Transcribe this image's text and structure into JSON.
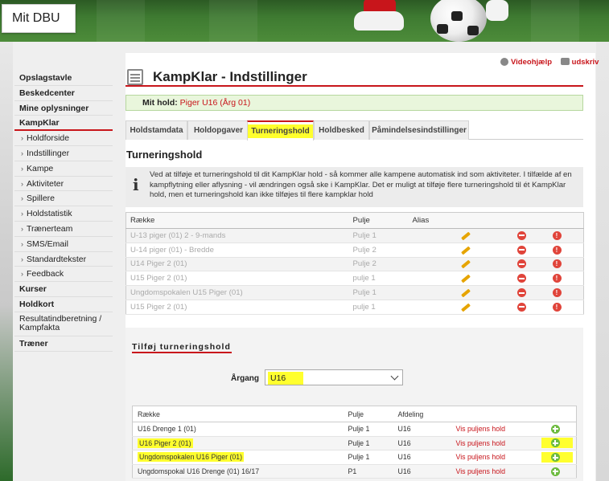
{
  "header": {
    "logo_text": "Mit DBU"
  },
  "top_links": {
    "video_help": "Videohjælp",
    "print": "udskriv"
  },
  "sidebar": {
    "items": [
      {
        "label": "Opslagstavle",
        "kind": "bold"
      },
      {
        "label": "Beskedcenter",
        "kind": "bold"
      },
      {
        "label": "Mine oplysninger",
        "kind": "bold"
      },
      {
        "label": "KampKlar",
        "kind": "active"
      },
      {
        "label": "Holdforside",
        "kind": "sub"
      },
      {
        "label": "Indstillinger",
        "kind": "sub"
      },
      {
        "label": "Kampe",
        "kind": "sub"
      },
      {
        "label": "Aktiviteter",
        "kind": "sub"
      },
      {
        "label": "Spillere",
        "kind": "sub"
      },
      {
        "label": "Holdstatistik",
        "kind": "sub"
      },
      {
        "label": "Trænerteam",
        "kind": "sub"
      },
      {
        "label": "SMS/Email",
        "kind": "sub"
      },
      {
        "label": "Standardtekster",
        "kind": "sub"
      },
      {
        "label": "Feedback",
        "kind": "sub"
      },
      {
        "label": "Kurser",
        "kind": "bold"
      },
      {
        "label": "Holdkort",
        "kind": "bold"
      },
      {
        "label": "Resultatindberetning / Kampfakta",
        "kind": "multi"
      },
      {
        "label": "Træner",
        "kind": "bold"
      }
    ]
  },
  "page": {
    "title": "KampKlar - Indstillinger",
    "my_team_label": "Mit hold:",
    "my_team_value": "Piger U16 (Årg 01)"
  },
  "tabs": [
    {
      "label": "Holdstamdata",
      "active": false
    },
    {
      "label": "Holdopgaver",
      "active": false
    },
    {
      "label": "Turneringshold",
      "active": true
    },
    {
      "label": "Holdbesked",
      "active": false
    },
    {
      "label": "Påmindelsesindstillinger",
      "active": false
    }
  ],
  "section": {
    "title": "Turneringshold",
    "info": "Ved at tilføje et turneringshold til dit KampKlar hold - så kommer alle kampene automatisk ind som aktiviteter. I tilfælde af en kampflytning eller aflysning - vil ændringen også ske i KampKlar. Det er muligt at tilføje flere turneringshold til ét KampKlar hold, men et turneringshold kan ikke tilføjes til flere kampklar hold"
  },
  "current_table": {
    "columns": [
      "Række",
      "Pulje",
      "Alias"
    ],
    "rows": [
      {
        "raekke": "U-13 piger (01) 2 - 9-mands",
        "pulje": "Pulje 1"
      },
      {
        "raekke": "U-14 piger (01) - Bredde",
        "pulje": "Pulje 2"
      },
      {
        "raekke": "U14 Piger 2 (01)",
        "pulje": "Pulje 2"
      },
      {
        "raekke": "U15 Piger 2 (01)",
        "pulje": "pulje 1"
      },
      {
        "raekke": "Ungdomspokalen U15 Piger (01)",
        "pulje": "Pulje 1"
      },
      {
        "raekke": "U15 Piger 2 (01)",
        "pulje": "pulje 1"
      }
    ]
  },
  "add_section": {
    "title": "Tilføj turneringshold",
    "aargang_label": "Årgang",
    "aargang_value": "U16",
    "columns": [
      "Række",
      "Pulje",
      "Afdeling"
    ],
    "rows": [
      {
        "raekke": "U16 Drenge 1 (01)",
        "pulje": "Pulje 1",
        "afdeling": "U16",
        "link": "Vis puljens hold",
        "highlight": false
      },
      {
        "raekke": "U16 Piger 2 (01)",
        "pulje": "Pulje 1",
        "afdeling": "U16",
        "link": "Vis puljens hold",
        "highlight": true
      },
      {
        "raekke": "Ungdomspokalen U16 Piger (01)",
        "pulje": "Pulje 1",
        "afdeling": "U16",
        "link": "Vis puljens hold",
        "highlight": true
      },
      {
        "raekke": "Ungdomspokal U16 Drenge (01) 16/17",
        "pulje": "P1",
        "afdeling": "U16",
        "link": "Vis puljens hold",
        "highlight": false
      }
    ]
  },
  "colors": {
    "accent_red": "#c8151b",
    "highlight_yellow": "#ffff2e",
    "success_green": "#6dbb3f"
  }
}
